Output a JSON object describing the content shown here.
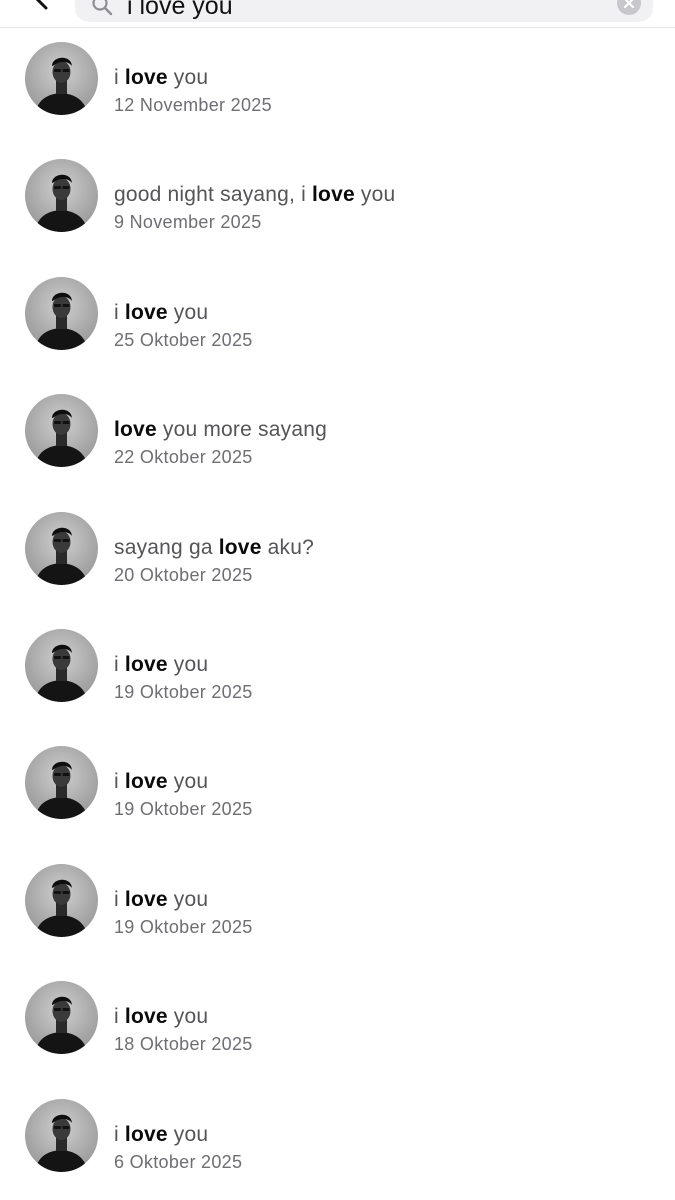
{
  "search": {
    "query": "i love you"
  },
  "results": [
    {
      "pre": "i ",
      "match": "love",
      "post": " you",
      "date": "12 November 2025"
    },
    {
      "pre": "good night sayang, i ",
      "match": "love",
      "post": " you",
      "date": "9 November 2025"
    },
    {
      "pre": "i ",
      "match": "love",
      "post": " you",
      "date": "25 Oktober 2025"
    },
    {
      "pre": "",
      "match": "love",
      "post": " you more sayang",
      "date": "22 Oktober 2025"
    },
    {
      "pre": "sayang ga ",
      "match": "love",
      "post": " aku?",
      "date": "20 Oktober 2025"
    },
    {
      "pre": "i ",
      "match": "love",
      "post": " you",
      "date": "19 Oktober 2025"
    },
    {
      "pre": "i ",
      "match": "love",
      "post": " you",
      "date": "19 Oktober 2025"
    },
    {
      "pre": "i ",
      "match": "love",
      "post": " you",
      "date": "19 Oktober 2025"
    },
    {
      "pre": "i ",
      "match": "love",
      "post": " you",
      "date": "18 Oktober 2025"
    },
    {
      "pre": "i ",
      "match": "love",
      "post": " you",
      "date": "6 Oktober 2025"
    }
  ]
}
